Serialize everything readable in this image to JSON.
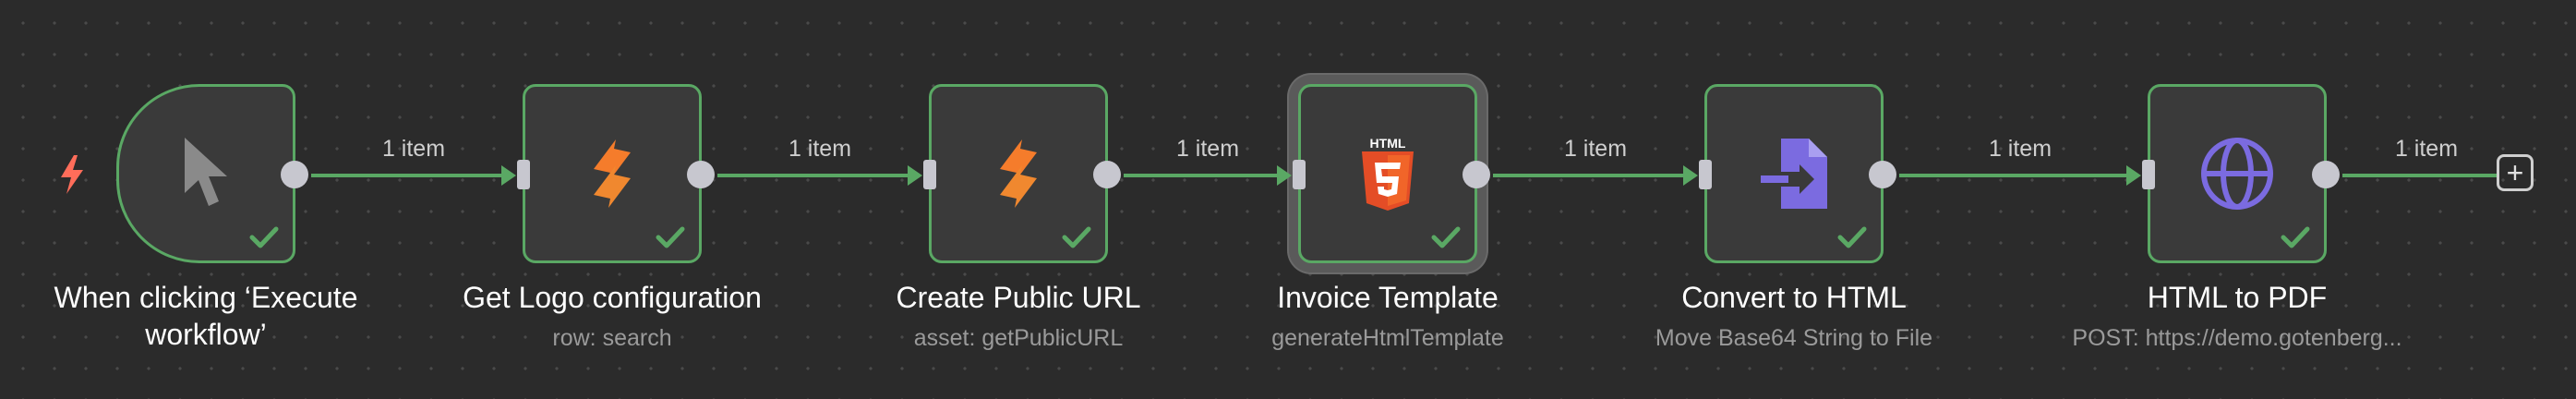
{
  "workflow": {
    "connection_label": "1 item",
    "add_node_symbol": "+",
    "nodes": [
      {
        "title": "When clicking ‘Execute workflow’",
        "subtitle": "",
        "icon": "cursor-icon",
        "status": "success"
      },
      {
        "title": "Get Logo configuration",
        "subtitle": "row: search",
        "icon": "supabase-icon",
        "status": "success"
      },
      {
        "title": "Create Public URL",
        "subtitle": "asset: getPublicURL",
        "icon": "supabase-icon",
        "status": "success"
      },
      {
        "title": "Invoice Template",
        "subtitle": "generateHtmlTemplate",
        "icon": "html5-icon",
        "status": "success",
        "selected": true
      },
      {
        "title": "Convert to HTML",
        "subtitle": "Move Base64 String to File",
        "icon": "file-import-icon",
        "status": "success"
      },
      {
        "title": "HTML to PDF",
        "subtitle": "POST: https://demo.gotenberg...",
        "icon": "globe-icon",
        "status": "success"
      }
    ]
  },
  "colors": {
    "success": "#5aa864",
    "trigger_bolt": "#ff6d5a",
    "supabase": "#f57c2b",
    "html5": "#e44d26",
    "purple": "#7b6be0"
  }
}
